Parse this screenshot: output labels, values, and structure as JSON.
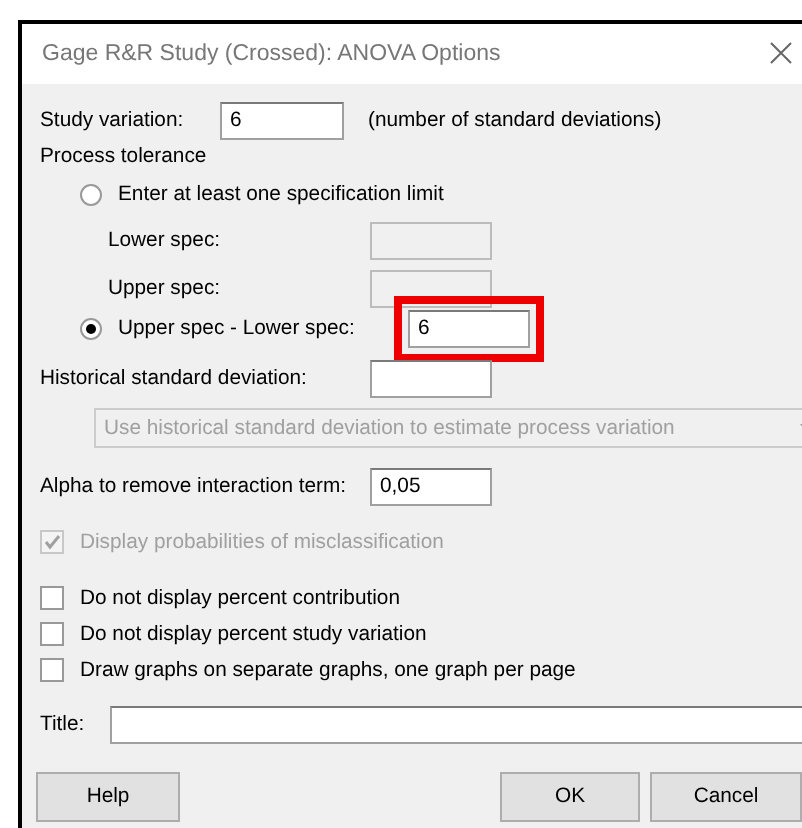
{
  "window": {
    "title": "Gage R&R Study (Crossed): ANOVA Options"
  },
  "study_variation": {
    "label": "Study variation:",
    "value": "6",
    "note": "(number of standard deviations)"
  },
  "process_tolerance": {
    "heading": "Process tolerance",
    "options": [
      {
        "label": "Enter at least one specification limit",
        "selected": false,
        "fields": [
          {
            "label": "Lower spec:",
            "disabled": true,
            "highlighted": false
          },
          {
            "label": "Upper spec:",
            "disabled": true,
            "highlighted": false
          }
        ]
      },
      {
        "label": "Upper spec - Lower spec:",
        "selected": true,
        "fields": [
          {
            "value": "6",
            "disabled": false,
            "highlighted": true
          }
        ]
      }
    ]
  },
  "historical_sd": {
    "label": "Historical standard deviation:"
  },
  "dropdown": {
    "value": "Use historical standard deviation to estimate process variation",
    "disabled": true
  },
  "alpha": {
    "label": "Alpha to remove interaction term:",
    "value": "0,05"
  },
  "checkboxes": [
    {
      "label": "Display probabilities of misclassification",
      "checked": true,
      "disabled": true
    },
    {
      "label": "Do not display percent contribution",
      "checked": false,
      "disabled": false
    },
    {
      "label": "Do not display percent study variation",
      "checked": false,
      "disabled": false
    },
    {
      "label": "Draw graphs on separate graphs, one graph per page",
      "checked": false,
      "disabled": false
    }
  ],
  "title_field": {
    "label": "Title:"
  },
  "buttons": [
    "Help",
    "OK",
    "Cancel"
  ]
}
